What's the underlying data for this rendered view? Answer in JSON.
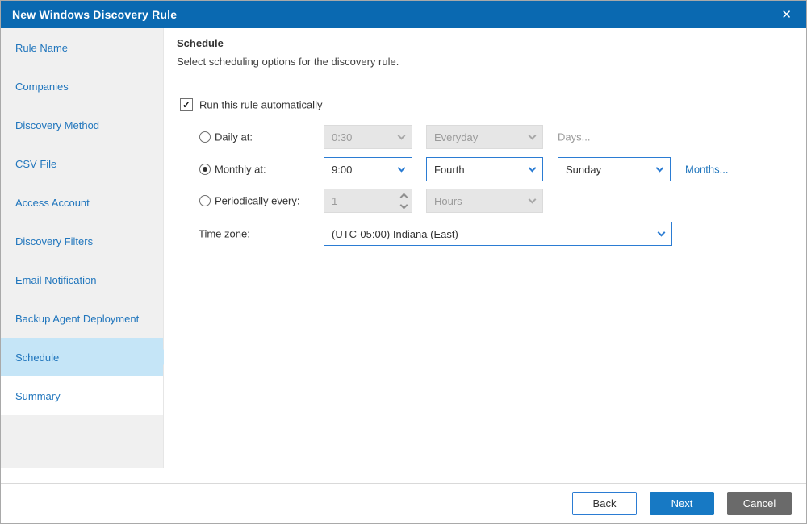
{
  "window": {
    "title": "New Windows Discovery Rule"
  },
  "icons": {
    "close": "✕",
    "check": "✓"
  },
  "colors": {
    "titlebar": "#0a69b1",
    "accent": "#2b7cd3",
    "sidebar_link": "#2176bd",
    "selected_item_bg": "#c5e5f7",
    "next_button_bg": "#1779c4",
    "cancel_button_bg": "#6a6a6a"
  },
  "sidebar": {
    "items": [
      {
        "label": "Rule Name",
        "selected": false
      },
      {
        "label": "Companies",
        "selected": false
      },
      {
        "label": "Discovery Method",
        "selected": false
      },
      {
        "label": "CSV File",
        "selected": false
      },
      {
        "label": "Access Account",
        "selected": false
      },
      {
        "label": "Discovery Filters",
        "selected": false
      },
      {
        "label": "Email Notification",
        "selected": false
      },
      {
        "label": "Backup Agent Deployment",
        "selected": false
      },
      {
        "label": "Schedule",
        "selected": true
      },
      {
        "label": "Summary",
        "selected": false
      }
    ]
  },
  "content": {
    "heading": "Schedule",
    "subtitle": "Select scheduling options for the discovery rule.",
    "run_checkbox_label": "Run this rule automatically",
    "daily": {
      "label": "Daily at:",
      "time": "0:30",
      "day": "Everyday",
      "days_link": "Days...",
      "enabled": false
    },
    "monthly": {
      "label": "Monthly at:",
      "time": "9:00",
      "week": "Fourth",
      "weekday": "Sunday",
      "months_link": "Months...",
      "enabled": true
    },
    "periodic": {
      "label": "Periodically every:",
      "value": "1",
      "unit": "Hours",
      "enabled": false
    },
    "timezone": {
      "label": "Time zone:",
      "value": "(UTC-05:00) Indiana (East)"
    }
  },
  "footer": {
    "back_label": "Back",
    "next_label": "Next",
    "cancel_label": "Cancel"
  }
}
